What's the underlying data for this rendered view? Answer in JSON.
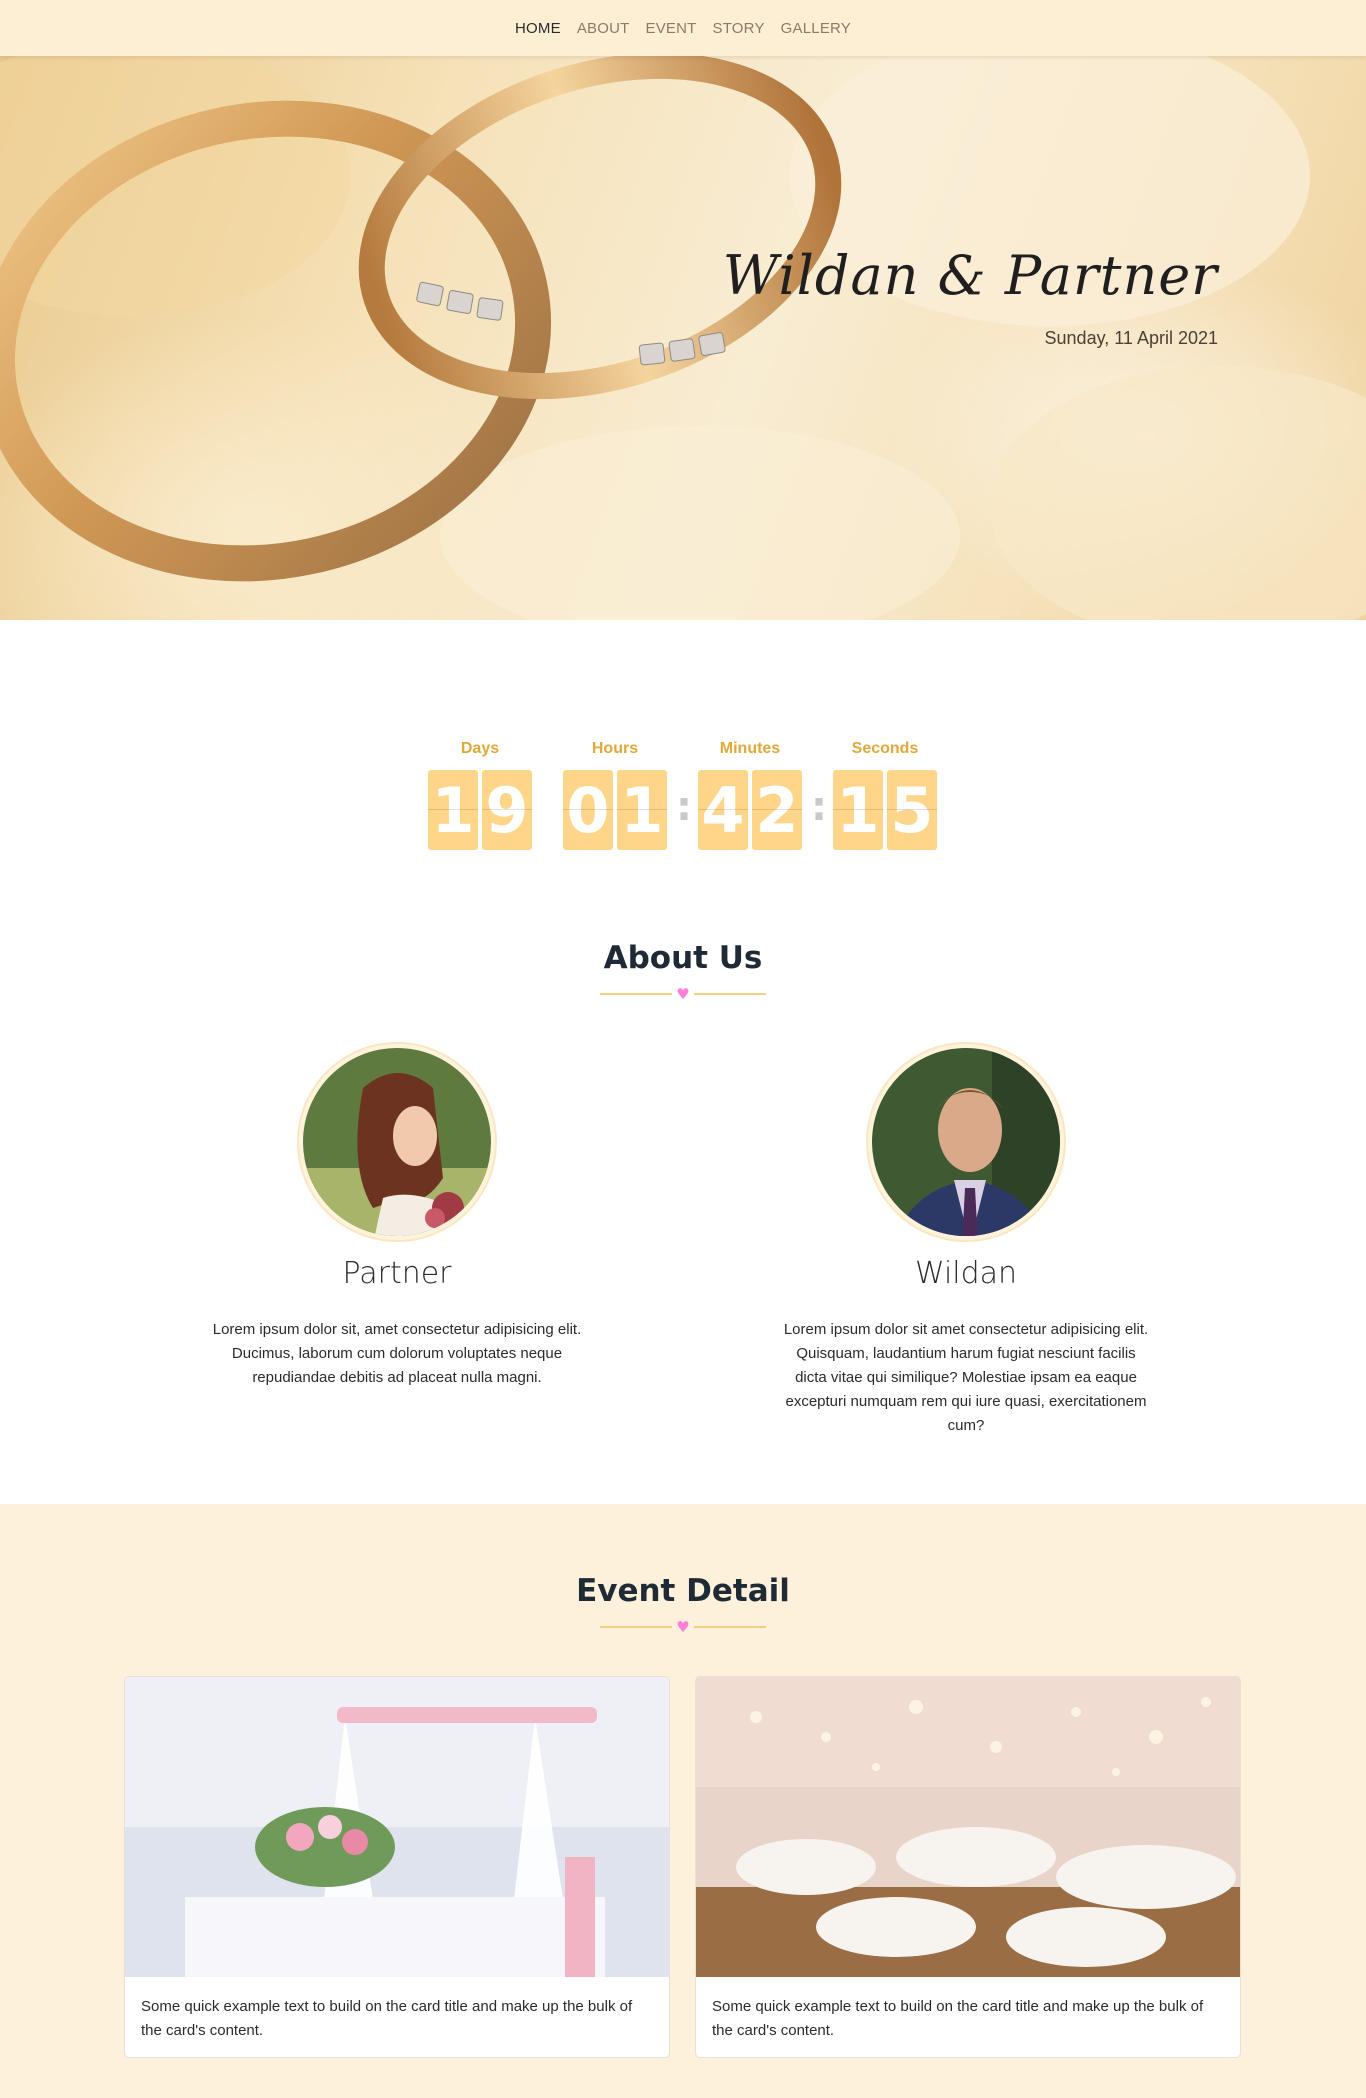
{
  "nav": {
    "items": [
      {
        "label": "HOME",
        "active": true
      },
      {
        "label": "ABOUT",
        "active": false
      },
      {
        "label": "EVENT",
        "active": false
      },
      {
        "label": "STORY",
        "active": false
      },
      {
        "label": "GALLERY",
        "active": false
      }
    ]
  },
  "hero": {
    "title": "Wildan & Partner",
    "date": "Sunday, 11 April 2021",
    "image_icon": "wedding-rings-photo"
  },
  "countdown": {
    "days_label": "Days",
    "hours_label": "Hours",
    "minutes_label": "Minutes",
    "seconds_label": "Seconds",
    "days": [
      "1",
      "9"
    ],
    "hours": [
      "0",
      "1"
    ],
    "minutes": [
      "4",
      "2"
    ],
    "seconds": [
      "1",
      "5"
    ],
    "separator": ":"
  },
  "about": {
    "title": "About Us",
    "heart": "♥",
    "partner": {
      "name": "Partner",
      "bio": "Lorem ipsum dolor sit, amet consectetur adipisicing elit. Ducimus, laborum cum dolorum voluptates neque repudiandae debitis ad placeat nulla magni."
    },
    "groom": {
      "name": "Wildan",
      "bio": "Lorem ipsum dolor sit amet consectetur adipisicing elit. Quisquam, laudantium harum fugiat nesciunt facilis dicta vitae qui similique? Molestiae ipsam ea eaque excepturi numquam rem qui iure quasi, exercitationem cum?"
    }
  },
  "events": {
    "title": "Event Detail",
    "heart": "♥",
    "cards": [
      {
        "text": "Some quick example text to build on the card title and make up the bulk of the card's content."
      },
      {
        "text": "Some quick example text to build on the card title and make up the bulk of the card's content."
      }
    ]
  },
  "colors": {
    "navbar_bg": "#fdefd3",
    "accent": "#ffd58a",
    "countdown_label": "#e0a93a",
    "divider_line": "#f4cf7e",
    "heart": "#ff7fd9",
    "event_bg": "#fdf1dc"
  }
}
